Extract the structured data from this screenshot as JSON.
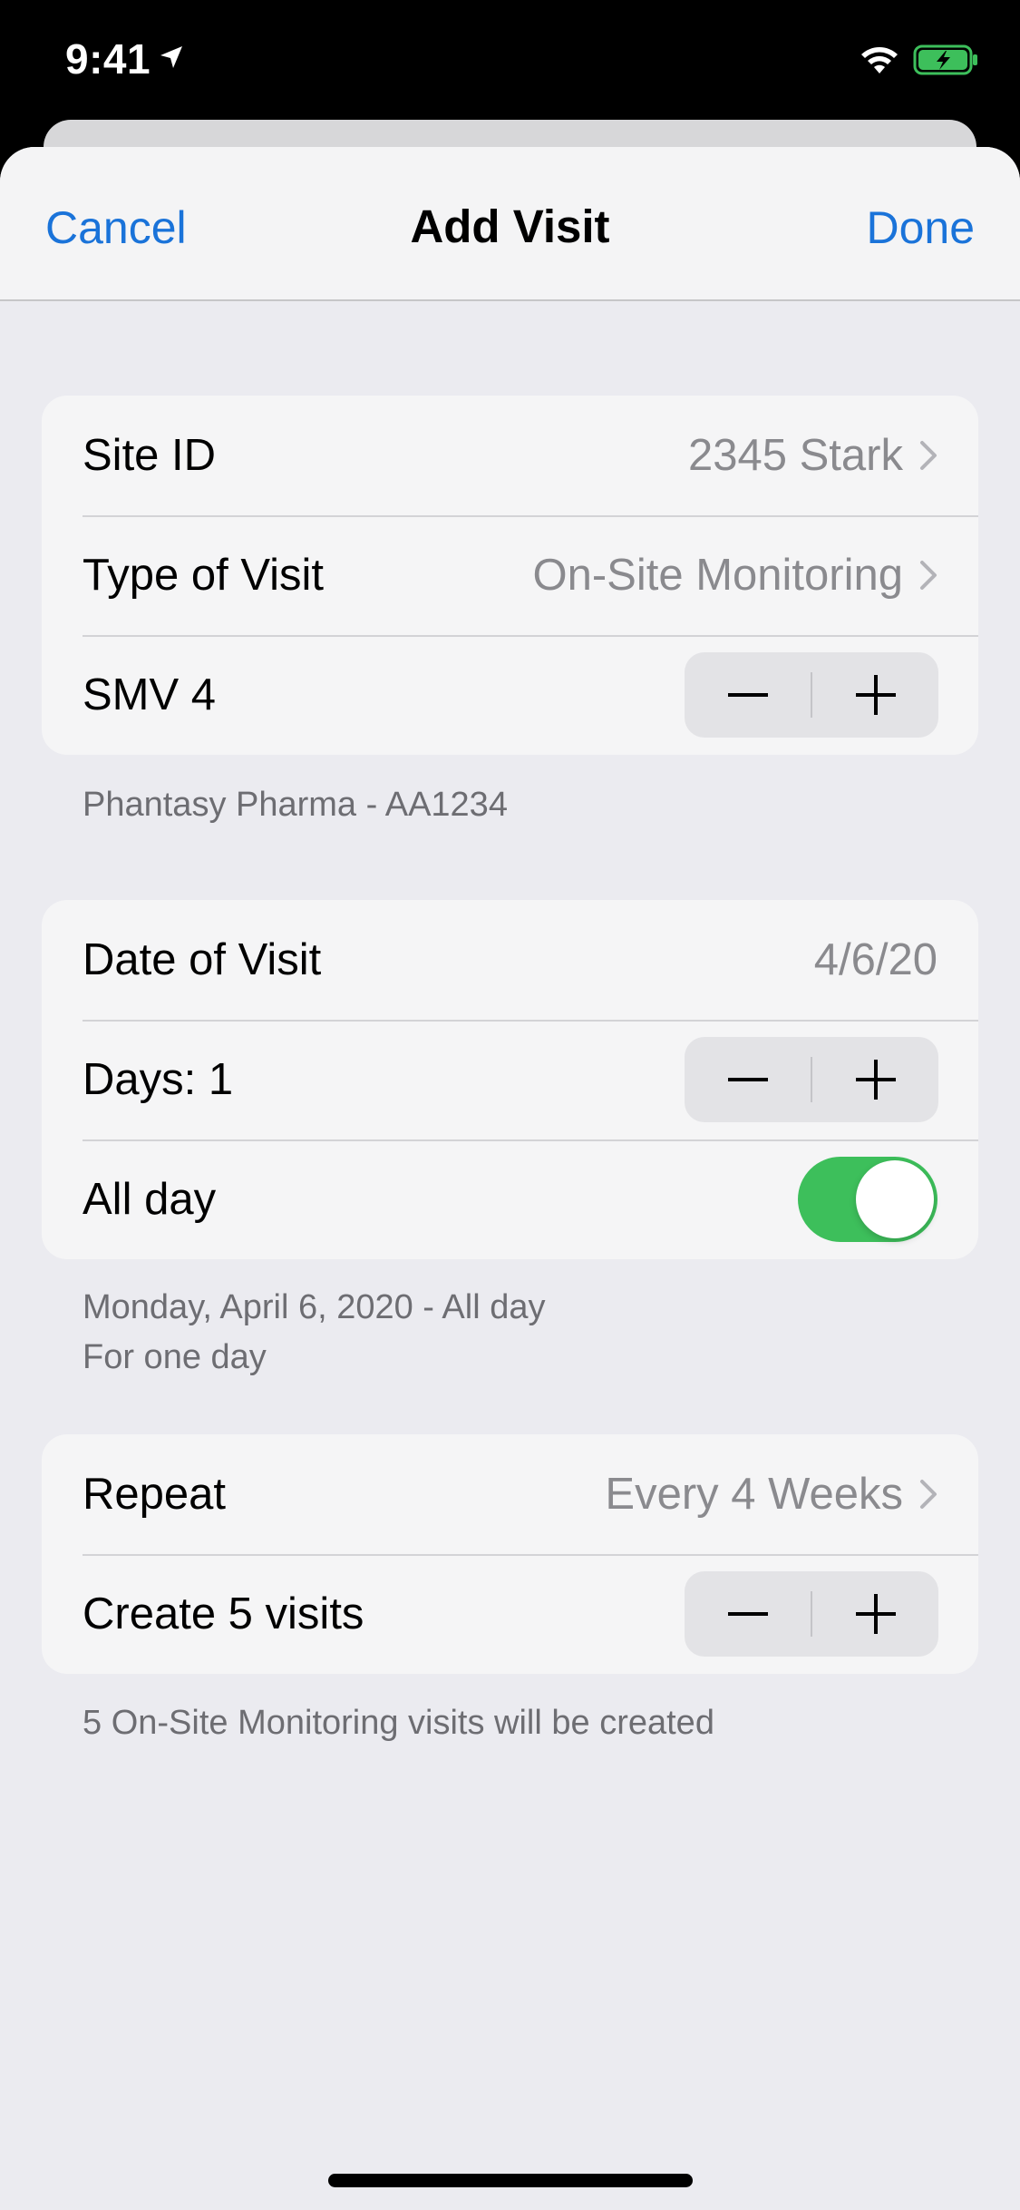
{
  "status_bar": {
    "time": "9:41",
    "icons": [
      "location-arrow-icon",
      "wifi-icon",
      "battery-charging-icon"
    ],
    "battery_color": "#3dbf5b"
  },
  "nav": {
    "cancel_label": "Cancel",
    "title": "Add Visit",
    "done_label": "Done",
    "accent_color": "#1a73d9"
  },
  "group1": {
    "site_id": {
      "label": "Site ID",
      "value": "2345 Stark"
    },
    "visit_type": {
      "label": "Type of Visit",
      "value": "On-Site Monitoring"
    },
    "smv": {
      "label": "SMV 4"
    },
    "footer": "Phantasy Pharma - AA1234"
  },
  "group2": {
    "date": {
      "label": "Date of Visit",
      "value": "4/6/20"
    },
    "days": {
      "label": "Days: 1"
    },
    "all_day": {
      "label": "All day",
      "on": true
    },
    "footer_line1": "Monday, April 6, 2020 - All day",
    "footer_line2": "For one day"
  },
  "group3": {
    "repeat": {
      "label": "Repeat",
      "value": "Every 4 Weeks"
    },
    "create": {
      "label": "Create 5 visits"
    },
    "footer": "5 On-Site Monitoring visits will be created"
  }
}
